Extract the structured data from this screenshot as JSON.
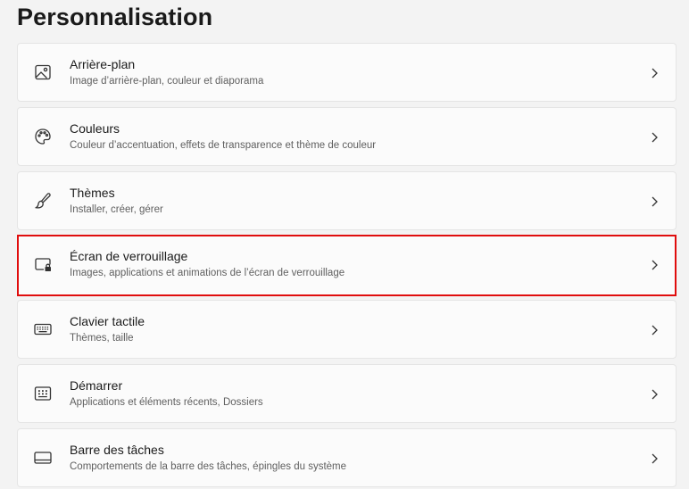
{
  "page": {
    "title": "Personnalisation"
  },
  "items": [
    {
      "title": "Arrière-plan",
      "subtitle": "Image d’arrière-plan, couleur et diaporama",
      "icon": "image-icon"
    },
    {
      "title": "Couleurs",
      "subtitle": "Couleur d’accentuation, effets de transparence et thème de couleur",
      "icon": "palette-icon"
    },
    {
      "title": "Thèmes",
      "subtitle": "Installer, créer, gérer",
      "icon": "brush-icon"
    },
    {
      "title": "Écran de verrouillage",
      "subtitle": "Images, applications et animations de l’écran de verrouillage",
      "icon": "lock-screen-icon"
    },
    {
      "title": "Clavier tactile",
      "subtitle": "Thèmes, taille",
      "icon": "keyboard-icon"
    },
    {
      "title": "Démarrer",
      "subtitle": "Applications et éléments récents, Dossiers",
      "icon": "start-icon"
    },
    {
      "title": "Barre des tâches",
      "subtitle": "Comportements de la barre des tâches, épingles du système",
      "icon": "taskbar-icon"
    }
  ],
  "highlight_color": "#e00d0d"
}
